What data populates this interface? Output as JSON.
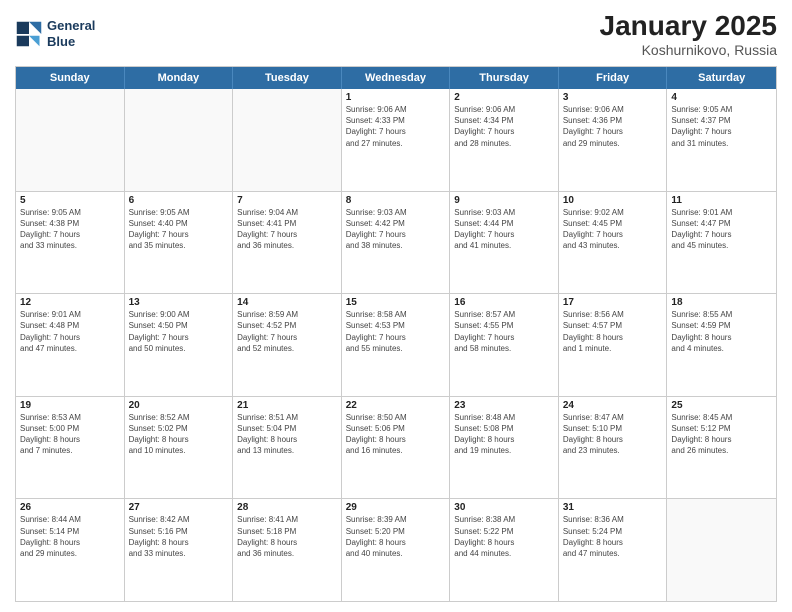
{
  "header": {
    "logo": {
      "line1": "General",
      "line2": "Blue"
    },
    "title": "January 2025",
    "subtitle": "Koshurnikovo, Russia"
  },
  "dayHeaders": [
    "Sunday",
    "Monday",
    "Tuesday",
    "Wednesday",
    "Thursday",
    "Friday",
    "Saturday"
  ],
  "weeks": [
    [
      {
        "day": "",
        "info": ""
      },
      {
        "day": "",
        "info": ""
      },
      {
        "day": "",
        "info": ""
      },
      {
        "day": "1",
        "info": "Sunrise: 9:06 AM\nSunset: 4:33 PM\nDaylight: 7 hours\nand 27 minutes."
      },
      {
        "day": "2",
        "info": "Sunrise: 9:06 AM\nSunset: 4:34 PM\nDaylight: 7 hours\nand 28 minutes."
      },
      {
        "day": "3",
        "info": "Sunrise: 9:06 AM\nSunset: 4:36 PM\nDaylight: 7 hours\nand 29 minutes."
      },
      {
        "day": "4",
        "info": "Sunrise: 9:05 AM\nSunset: 4:37 PM\nDaylight: 7 hours\nand 31 minutes."
      }
    ],
    [
      {
        "day": "5",
        "info": "Sunrise: 9:05 AM\nSunset: 4:38 PM\nDaylight: 7 hours\nand 33 minutes."
      },
      {
        "day": "6",
        "info": "Sunrise: 9:05 AM\nSunset: 4:40 PM\nDaylight: 7 hours\nand 35 minutes."
      },
      {
        "day": "7",
        "info": "Sunrise: 9:04 AM\nSunset: 4:41 PM\nDaylight: 7 hours\nand 36 minutes."
      },
      {
        "day": "8",
        "info": "Sunrise: 9:03 AM\nSunset: 4:42 PM\nDaylight: 7 hours\nand 38 minutes."
      },
      {
        "day": "9",
        "info": "Sunrise: 9:03 AM\nSunset: 4:44 PM\nDaylight: 7 hours\nand 41 minutes."
      },
      {
        "day": "10",
        "info": "Sunrise: 9:02 AM\nSunset: 4:45 PM\nDaylight: 7 hours\nand 43 minutes."
      },
      {
        "day": "11",
        "info": "Sunrise: 9:01 AM\nSunset: 4:47 PM\nDaylight: 7 hours\nand 45 minutes."
      }
    ],
    [
      {
        "day": "12",
        "info": "Sunrise: 9:01 AM\nSunset: 4:48 PM\nDaylight: 7 hours\nand 47 minutes."
      },
      {
        "day": "13",
        "info": "Sunrise: 9:00 AM\nSunset: 4:50 PM\nDaylight: 7 hours\nand 50 minutes."
      },
      {
        "day": "14",
        "info": "Sunrise: 8:59 AM\nSunset: 4:52 PM\nDaylight: 7 hours\nand 52 minutes."
      },
      {
        "day": "15",
        "info": "Sunrise: 8:58 AM\nSunset: 4:53 PM\nDaylight: 7 hours\nand 55 minutes."
      },
      {
        "day": "16",
        "info": "Sunrise: 8:57 AM\nSunset: 4:55 PM\nDaylight: 7 hours\nand 58 minutes."
      },
      {
        "day": "17",
        "info": "Sunrise: 8:56 AM\nSunset: 4:57 PM\nDaylight: 8 hours\nand 1 minute."
      },
      {
        "day": "18",
        "info": "Sunrise: 8:55 AM\nSunset: 4:59 PM\nDaylight: 8 hours\nand 4 minutes."
      }
    ],
    [
      {
        "day": "19",
        "info": "Sunrise: 8:53 AM\nSunset: 5:00 PM\nDaylight: 8 hours\nand 7 minutes."
      },
      {
        "day": "20",
        "info": "Sunrise: 8:52 AM\nSunset: 5:02 PM\nDaylight: 8 hours\nand 10 minutes."
      },
      {
        "day": "21",
        "info": "Sunrise: 8:51 AM\nSunset: 5:04 PM\nDaylight: 8 hours\nand 13 minutes."
      },
      {
        "day": "22",
        "info": "Sunrise: 8:50 AM\nSunset: 5:06 PM\nDaylight: 8 hours\nand 16 minutes."
      },
      {
        "day": "23",
        "info": "Sunrise: 8:48 AM\nSunset: 5:08 PM\nDaylight: 8 hours\nand 19 minutes."
      },
      {
        "day": "24",
        "info": "Sunrise: 8:47 AM\nSunset: 5:10 PM\nDaylight: 8 hours\nand 23 minutes."
      },
      {
        "day": "25",
        "info": "Sunrise: 8:45 AM\nSunset: 5:12 PM\nDaylight: 8 hours\nand 26 minutes."
      }
    ],
    [
      {
        "day": "26",
        "info": "Sunrise: 8:44 AM\nSunset: 5:14 PM\nDaylight: 8 hours\nand 29 minutes."
      },
      {
        "day": "27",
        "info": "Sunrise: 8:42 AM\nSunset: 5:16 PM\nDaylight: 8 hours\nand 33 minutes."
      },
      {
        "day": "28",
        "info": "Sunrise: 8:41 AM\nSunset: 5:18 PM\nDaylight: 8 hours\nand 36 minutes."
      },
      {
        "day": "29",
        "info": "Sunrise: 8:39 AM\nSunset: 5:20 PM\nDaylight: 8 hours\nand 40 minutes."
      },
      {
        "day": "30",
        "info": "Sunrise: 8:38 AM\nSunset: 5:22 PM\nDaylight: 8 hours\nand 44 minutes."
      },
      {
        "day": "31",
        "info": "Sunrise: 8:36 AM\nSunset: 5:24 PM\nDaylight: 8 hours\nand 47 minutes."
      },
      {
        "day": "",
        "info": ""
      }
    ]
  ]
}
